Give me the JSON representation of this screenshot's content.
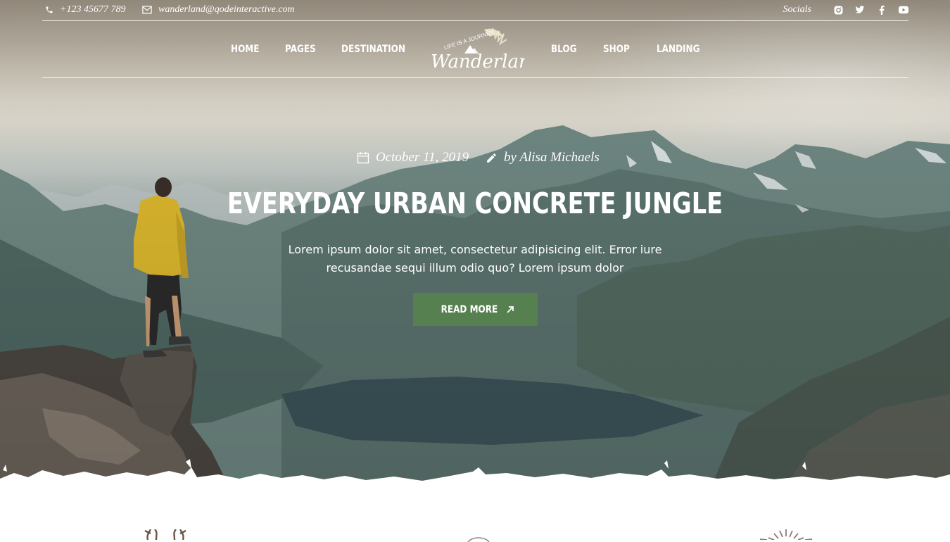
{
  "topbar": {
    "phone": "+123 45677 789",
    "email": "wanderland@qodeinteractive.com",
    "socials_label": "Socials",
    "social_icons": [
      "instagram-icon",
      "twitter-icon",
      "facebook-icon",
      "youtube-icon"
    ]
  },
  "nav": {
    "left_items": [
      "HOME",
      "PAGES",
      "DESTINATION"
    ],
    "right_items": [
      "BLOG",
      "SHOP",
      "LANDING"
    ],
    "logo_text": "Wanderland",
    "logo_tagline": "LIFE IS A JOURNEY"
  },
  "post": {
    "date": "October 11, 2019",
    "author": "by Alisa Michaels",
    "title": "EVERYDAY URBAN CONCRETE JUNGLE",
    "excerpt": "Lorem ipsum dolor sit amet, consectetur adipisicing elit. Error iure recusandae sequi illum odio quo? Lorem ipsum dolor",
    "button_label": "READ MORE"
  },
  "colors": {
    "accent": "#56804f",
    "text_on_hero": "#ffffff",
    "icon_brown": "#6b5448"
  }
}
